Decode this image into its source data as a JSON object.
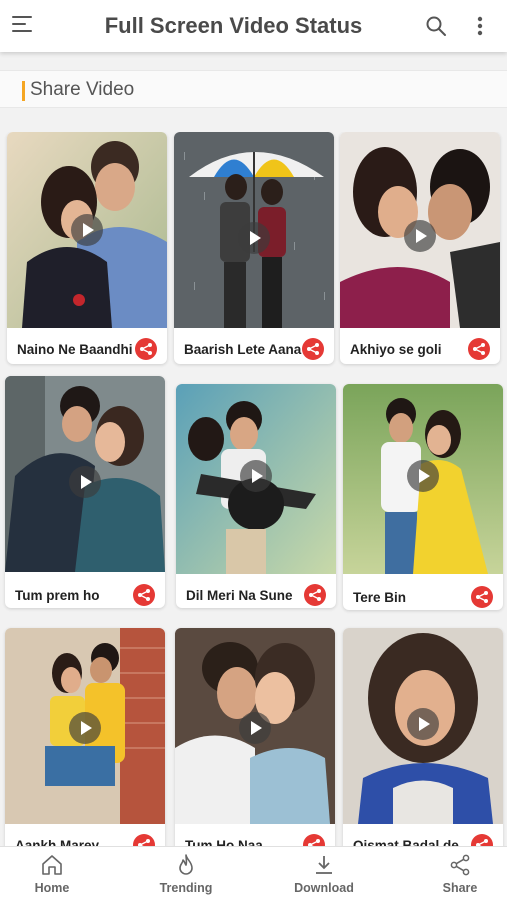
{
  "app": {
    "title": "Full Screen Video Status"
  },
  "section": {
    "title": "Share Video"
  },
  "videos": [
    {
      "title": "Naino Ne Baandhi"
    },
    {
      "title": "Baarish Lete Aana"
    },
    {
      "title": "Akhiyo se goli"
    },
    {
      "title": "Tum prem ho"
    },
    {
      "title": "Dil Meri Na Sune"
    },
    {
      "title": "Tere Bin"
    },
    {
      "title": "Aankh Marey"
    },
    {
      "title": "Tum Ho Naa"
    },
    {
      "title": "Qismat Badal de"
    }
  ],
  "nav": {
    "home": "Home",
    "trending": "Trending",
    "download": "Download",
    "share": "Share"
  },
  "icons": {
    "menu": "hamburger-icon",
    "search": "search-icon",
    "more": "more-vertical-icon",
    "play": "play-icon",
    "share": "share-icon",
    "home": "home-icon",
    "trending": "flame-icon",
    "download": "download-icon"
  },
  "colors": {
    "accent": "#f5a623",
    "share_button": "#e53935",
    "title_text": "#4a4a4a"
  }
}
